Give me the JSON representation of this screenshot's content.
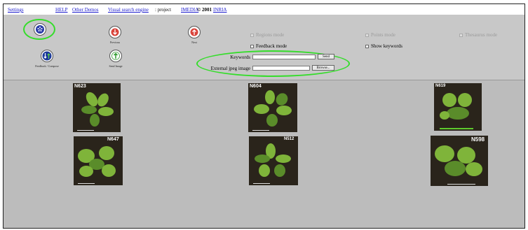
{
  "topbar": {
    "settings": "Settings",
    "help": "HELP",
    "other_demos": "Other Demos",
    "visual_search": "Visual search engine",
    "project_prefix": ": project",
    "imedia": "IMEDIA",
    "copyright": "© 2001",
    "inria": "INRIA"
  },
  "toolbar": {
    "buttons": [
      {
        "label": ""
      },
      {
        "label": "Previous"
      },
      {
        "label": "Next"
      },
      {
        "label": "Feedback / Compose"
      },
      {
        "label": "Send Image"
      }
    ],
    "modes": {
      "regions": "Regions mode",
      "feedback": "Feedback mode",
      "points": "Points mode",
      "show_keywords": "Show keywords",
      "thesaurus": "Thesaurus mode"
    },
    "keywords_label": "Keywords",
    "keywords_value": "",
    "send_label": "Send",
    "external_label": "External jpeg image",
    "external_value": "",
    "browse_label": "Browse..."
  },
  "gallery": {
    "codes": [
      "N623",
      "N604",
      "N619",
      "N647",
      "N512",
      "N598"
    ]
  },
  "colors": {
    "highlight": "#34dd2a",
    "link": "#1a1acc",
    "toolbar_bg": "#c8c8c8",
    "gallery_bg": "#bcbcbc"
  }
}
